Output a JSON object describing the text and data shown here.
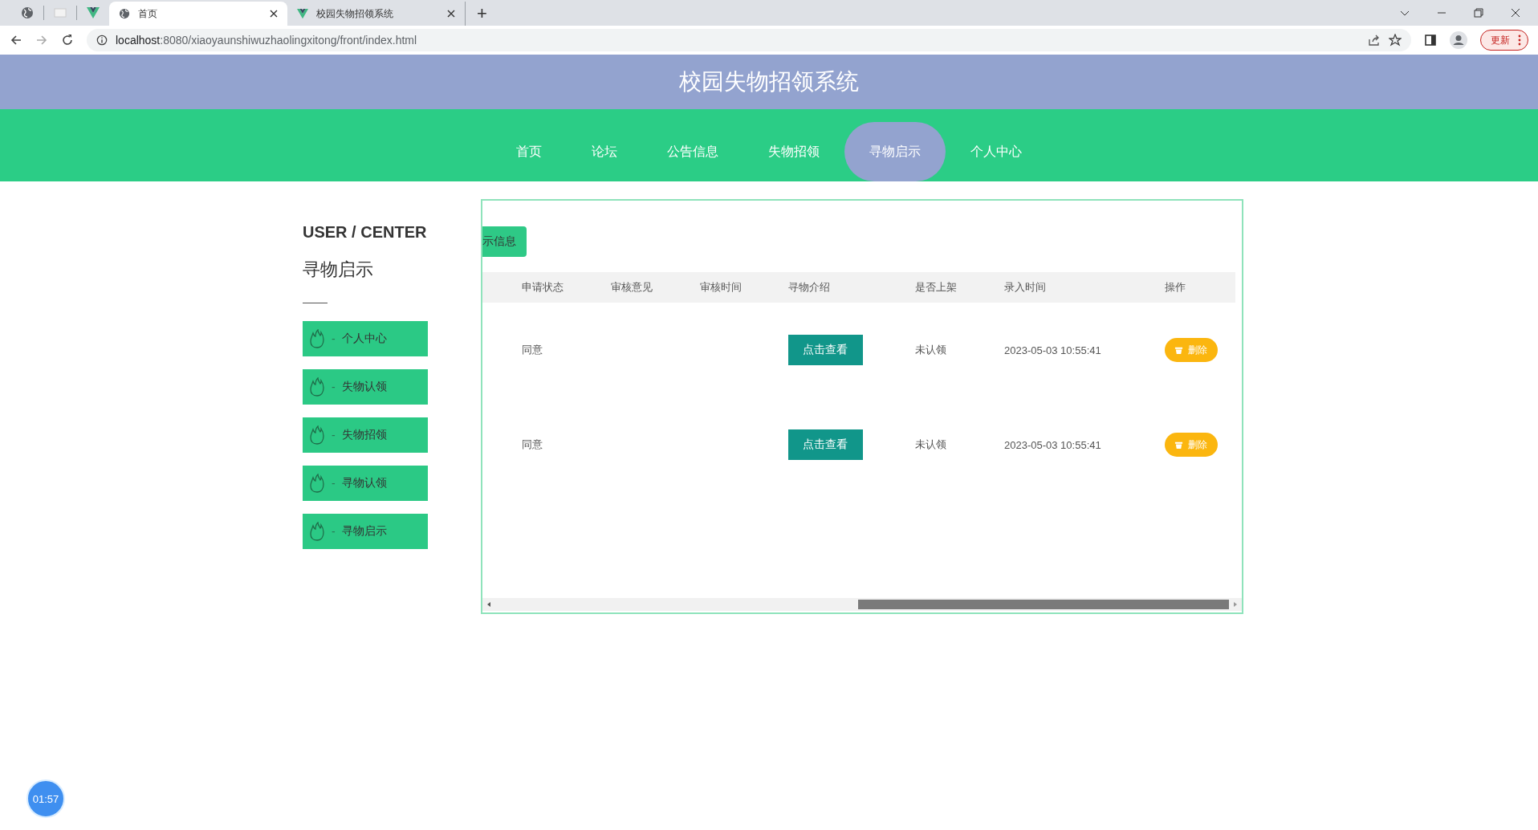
{
  "browser": {
    "tabs": [
      {
        "kind": "site",
        "title": "首页",
        "selected": true
      },
      {
        "kind": "app",
        "title": "校园失物招领系统",
        "selected": false
      }
    ],
    "new_tab": "+",
    "url_host": "localhost",
    "url_rest": ":8080/xiaoyaunshiwuzhaolingxitong/front/index.html",
    "update_button": "更新"
  },
  "header": {
    "title": "校园失物招领系统"
  },
  "nav": [
    {
      "label": "首页",
      "selected": false
    },
    {
      "label": "论坛",
      "selected": false
    },
    {
      "label": "公告信息",
      "selected": false
    },
    {
      "label": "失物招领",
      "selected": false
    },
    {
      "label": "寻物启示",
      "selected": true
    },
    {
      "label": "个人中心",
      "selected": false
    }
  ],
  "sidebar": {
    "heading": "USER / CENTER",
    "subtitle": "寻物启示",
    "items": [
      {
        "label": "个人中心"
      },
      {
        "label": "失物认领"
      },
      {
        "label": "失物招领"
      },
      {
        "label": "寻物认领"
      },
      {
        "label": "寻物启示"
      }
    ],
    "separator": "-"
  },
  "panel": {
    "action_button": "示信息",
    "table": {
      "columns": [
        "申请状态",
        "审核意见",
        "审核时间",
        "寻物介绍",
        "是否上架",
        "录入时间",
        "操作"
      ],
      "rows": [
        {
          "status": "同意",
          "intro_button": "点击查看",
          "listed": "未认领",
          "entry_time": "2023-05-03 10:55:41",
          "delete_button": "删除"
        },
        {
          "status": "同意",
          "intro_button": "点击查看",
          "listed": "未认领",
          "entry_time": "2023-05-03 10:55:41",
          "delete_button": "删除"
        }
      ]
    }
  },
  "timer": "01:57"
}
